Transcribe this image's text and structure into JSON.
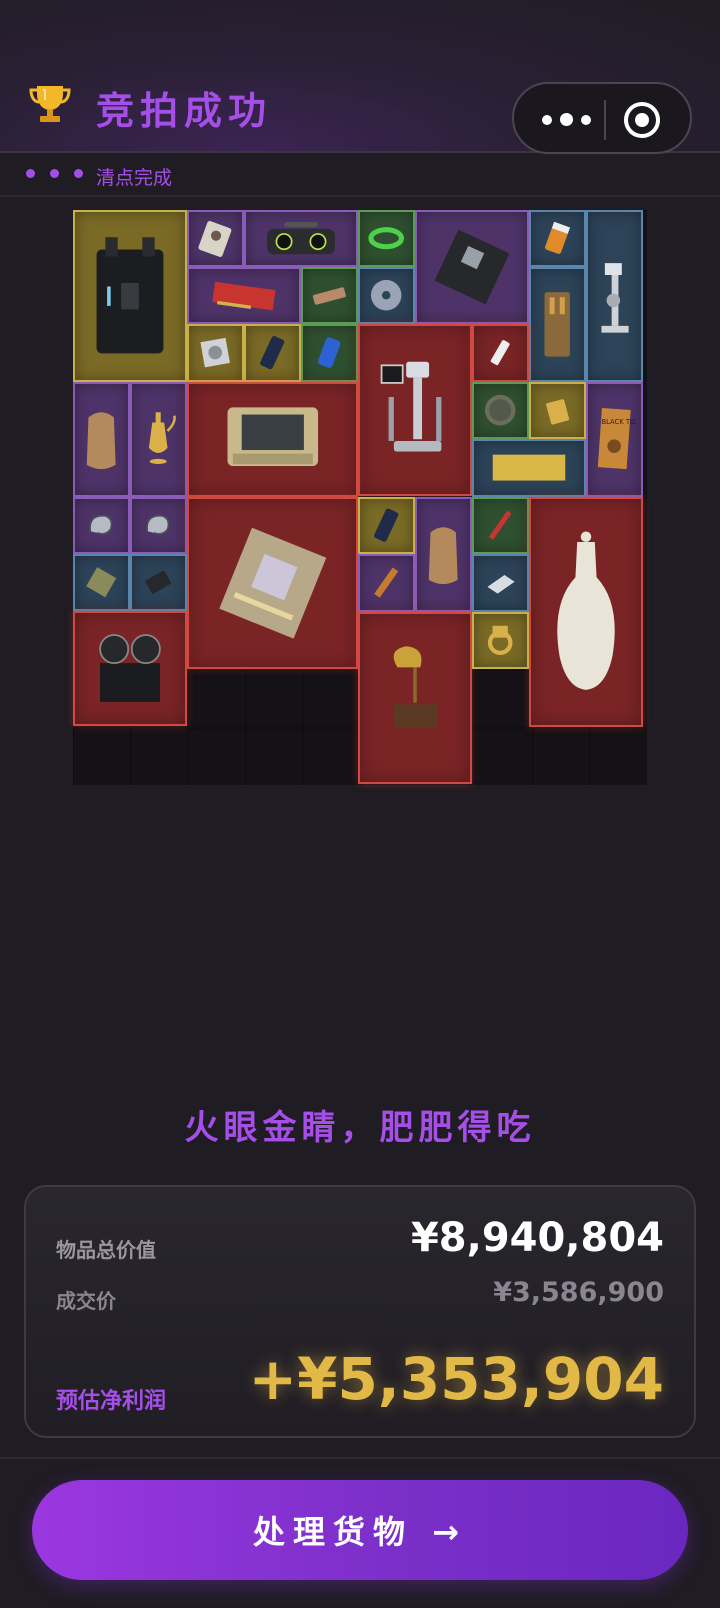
{
  "header": {
    "title": "竞拍成功",
    "trophy_icon": "trophy-icon",
    "menu_icon": "more-dots-icon",
    "close_icon": "target-circle-icon"
  },
  "subbar": {
    "status": "清点完成"
  },
  "loot_grid": {
    "items": [
      {
        "name": "hard-case",
        "rarity": "yellow"
      },
      {
        "name": "id-card",
        "rarity": "purple"
      },
      {
        "name": "boombox",
        "rarity": "purple"
      },
      {
        "name": "cable-coil",
        "rarity": "green"
      },
      {
        "name": "motherboard",
        "rarity": "purple"
      },
      {
        "name": "pill-bottle",
        "rarity": "blue"
      },
      {
        "name": "microscope",
        "rarity": "blue"
      },
      {
        "name": "graphics-card",
        "rarity": "purple"
      },
      {
        "name": "snack-bar",
        "rarity": "green"
      },
      {
        "name": "disc",
        "rarity": "blue"
      },
      {
        "name": "ammo-box",
        "rarity": "blue"
      },
      {
        "name": "hard-drive",
        "rarity": "yellow"
      },
      {
        "name": "phone",
        "rarity": "yellow"
      },
      {
        "name": "soda-can",
        "rarity": "green"
      },
      {
        "name": "robot-arm",
        "rarity": "red"
      },
      {
        "name": "usb-stick",
        "rarity": "red"
      },
      {
        "name": "sack",
        "rarity": "purple"
      },
      {
        "name": "gold-teapot",
        "rarity": "purple"
      },
      {
        "name": "rugged-terminal",
        "rarity": "red"
      },
      {
        "name": "coin",
        "rarity": "green"
      },
      {
        "name": "lighter",
        "rarity": "yellow"
      },
      {
        "name": "book-black-tide",
        "rarity": "purple"
      },
      {
        "name": "gold-bar",
        "rarity": "blue"
      },
      {
        "name": "earbud-left",
        "rarity": "purple"
      },
      {
        "name": "earbud-right",
        "rarity": "purple"
      },
      {
        "name": "processor-module",
        "rarity": "red"
      },
      {
        "name": "phone-2",
        "rarity": "yellow"
      },
      {
        "name": "sack-2",
        "rarity": "purple"
      },
      {
        "name": "screwdriver",
        "rarity": "green"
      },
      {
        "name": "porcelain-vase",
        "rarity": "red"
      },
      {
        "name": "bandage",
        "rarity": "blue"
      },
      {
        "name": "power-bank",
        "rarity": "blue"
      },
      {
        "name": "flashlight",
        "rarity": "purple"
      },
      {
        "name": "silver-ingot",
        "rarity": "blue"
      },
      {
        "name": "reel-recorder",
        "rarity": "red"
      },
      {
        "name": "gramophone",
        "rarity": "red"
      },
      {
        "name": "gold-ring",
        "rarity": "yellow"
      }
    ],
    "book_title": "BLACK TIDE"
  },
  "slogan": "火眼金睛，肥肥得吃",
  "summary": {
    "total_value_label": "物品总价值",
    "total_value": "¥8,940,804",
    "deal_price_label": "成交价",
    "deal_price": "¥3,586,900",
    "profit_label": "预估净利润",
    "profit": "+¥5,353,904"
  },
  "colors": {
    "accent_purple": "#a64fe8",
    "profit_gold": "#e2b847",
    "rarity_red": "#d04a44",
    "rarity_yellow": "#c9b048",
    "rarity_purple": "#8a5cb8",
    "rarity_blue": "#5a86ad",
    "rarity_green": "#5d9a58"
  },
  "cta": {
    "label": "处理货物 →"
  }
}
